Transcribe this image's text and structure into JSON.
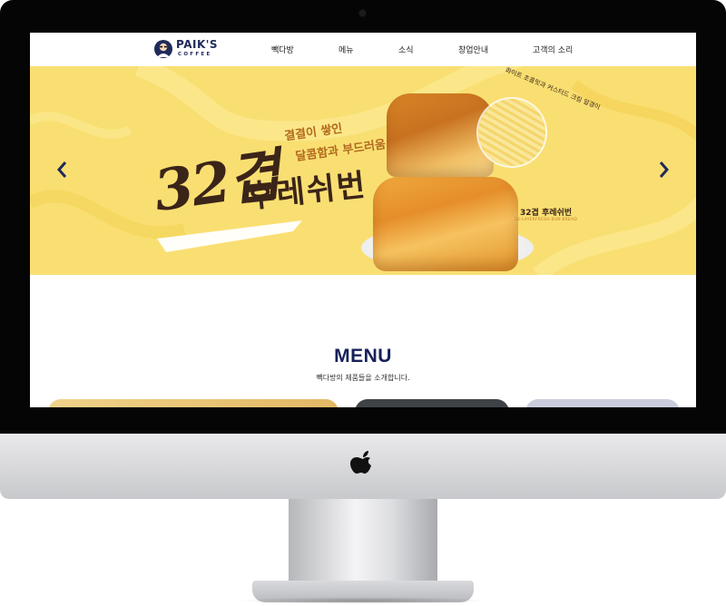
{
  "site": {
    "logo": {
      "name": "PAIK'S",
      "sub": "COFFEE"
    },
    "nav": [
      {
        "label": "빽다방"
      },
      {
        "label": "메뉴"
      },
      {
        "label": "소식"
      },
      {
        "label": "창업안내"
      },
      {
        "label": "고객의 소리"
      }
    ],
    "banner": {
      "headline_number": "32겹",
      "headline_word": "후레쉬번",
      "tagline_line1": "결결이 쌓인",
      "tagline_line2": "달콤함과 부드러움",
      "zoom_note": "화이트 초콜릿과 커스터드 크림 알갱이",
      "product_name": "32겹 후레쉬번",
      "product_name_en": "32-LAYERFRESH BUN BREAD",
      "slides_total": 4,
      "active_slide": 1,
      "background_color": "#f9df72"
    },
    "menu_section": {
      "title": "MENU",
      "description": "빽다방의 제품들을 소개합니다."
    },
    "brand_color": "#1e2a5a"
  },
  "device": {
    "type": "iMac",
    "logo": "apple-logo-icon"
  }
}
